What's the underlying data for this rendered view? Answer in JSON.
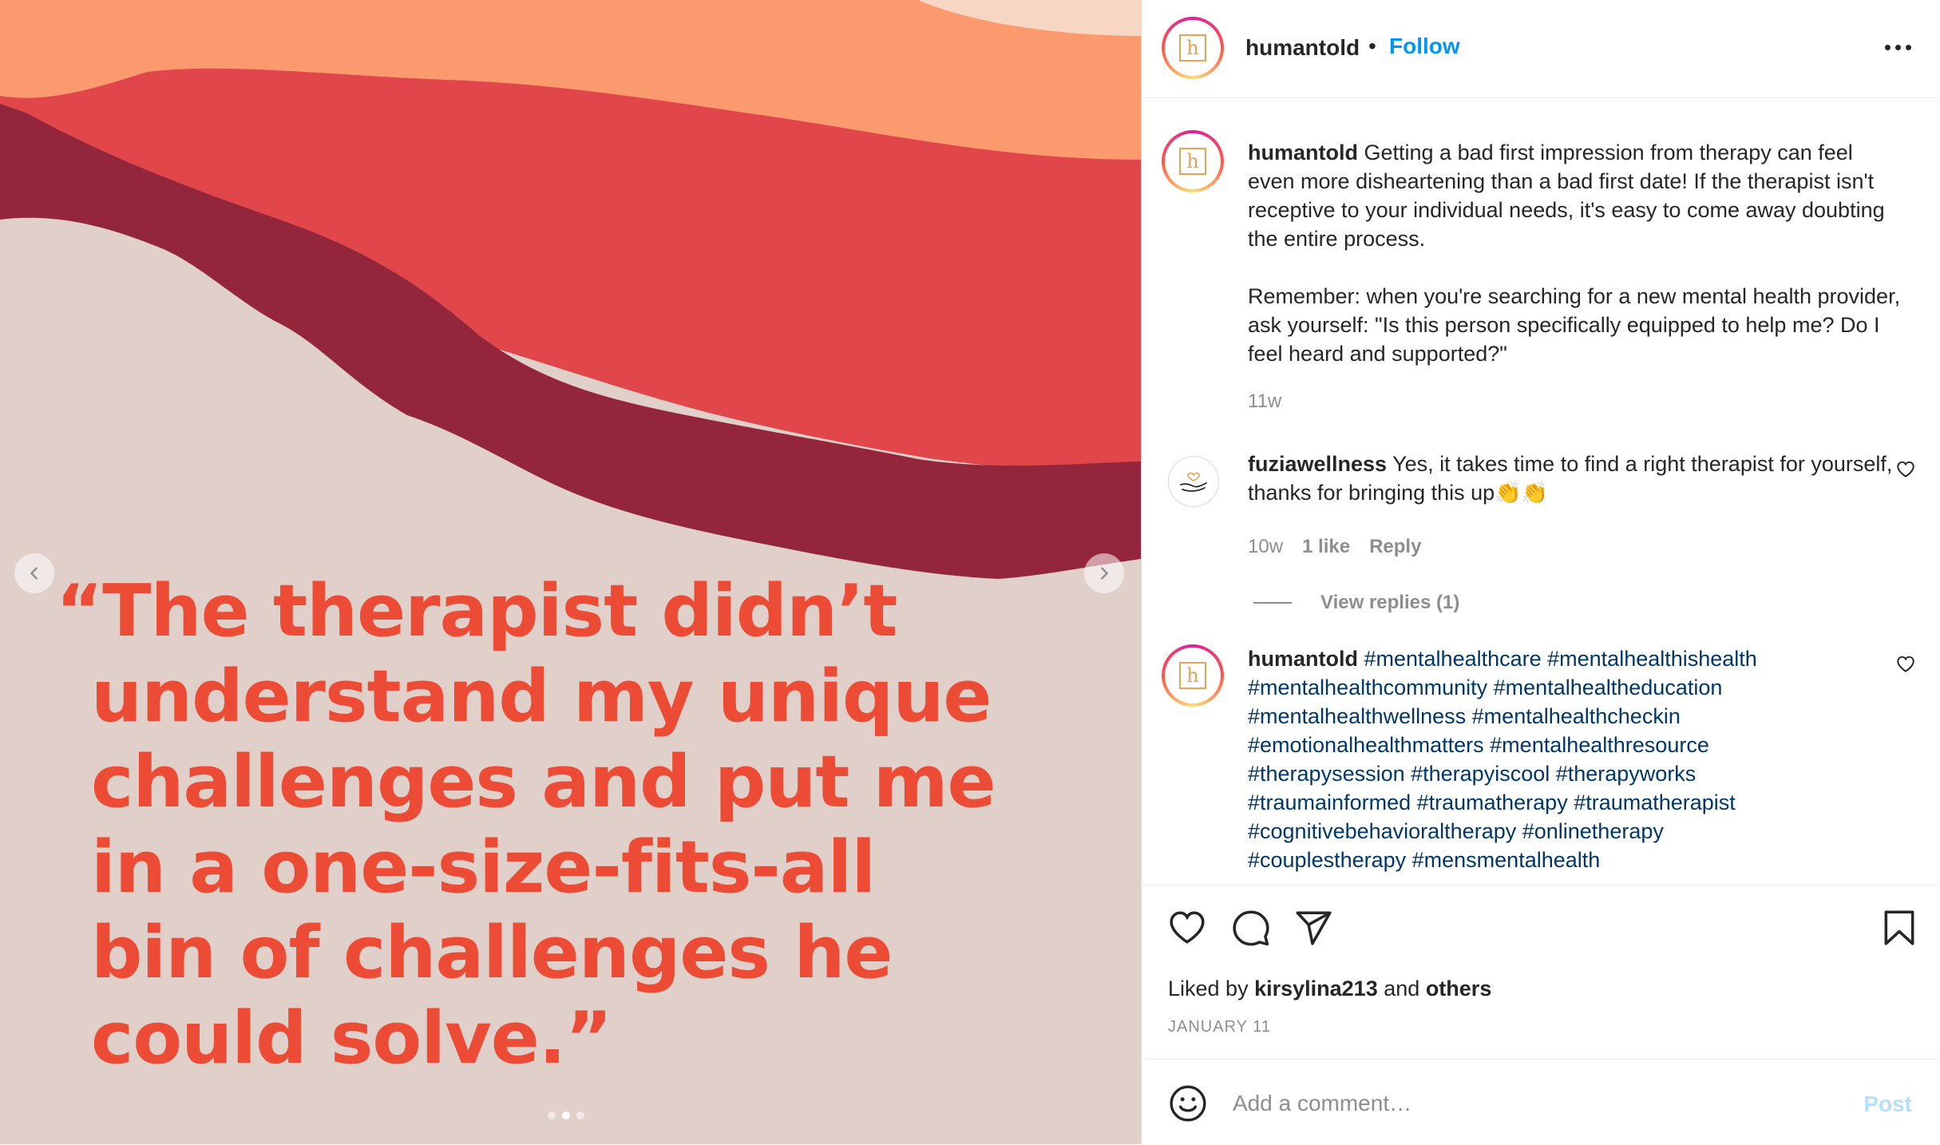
{
  "media": {
    "quote_lines": [
      "“The therapist didn’t",
      "understand my unique",
      "challenges and put me",
      "in a one-size-fits-all",
      "bin of challenges he",
      "could solve.”"
    ],
    "slide_count": 3,
    "active_slide": 2,
    "colors": {
      "background": "#e1cfc9",
      "band_peach": "#fb9a6e",
      "band_light": "#f7d7c4",
      "band_red": "#e0464a",
      "band_maroon": "#93263b",
      "quote_text": "#ec4c35"
    }
  },
  "header": {
    "username": "humantold",
    "separator": "•",
    "follow_label": "Follow",
    "avatar_letter": "h"
  },
  "caption": {
    "username": "humantold",
    "paragraph1": "Getting a bad first impression from therapy can feel even more disheartening than a bad first date! If the therapist isn't receptive to your individual needs, it's easy to come away doubting the entire process.",
    "paragraph2": "Remember: when you're searching for a new mental health provider, ask yourself: \"Is this person specifically equipped to help me? Do I feel heard and supported?\"",
    "time": "11w"
  },
  "comments": [
    {
      "username": "fuziawellness",
      "text": "Yes, it takes time to find a right therapist for yourself, thanks for bringing this up",
      "emoji": "👏👏",
      "time": "10w",
      "likes": "1 like",
      "reply_label": "Reply",
      "view_replies": "View replies (1)"
    },
    {
      "username": "humantold",
      "hashtags": "#mentalhealthcare #mentalhealthishealth #mentalhealthcommunity #mentalhealtheducation #mentalhealthwellness #mentalhealthcheckin #emotionalhealthmatters #mentalhealthresource #therapysession #therapyiscool #therapyworks #traumainformed #traumatherapy #traumatherapist #cognitivebehavioraltherapy #onlinetherapy #couplestherapy #mensmentalhealth"
    }
  ],
  "actions": {
    "liked_by_prefix": "Liked by",
    "liked_by_user": "kirsylina213",
    "liked_by_and": "and",
    "liked_by_others": "others",
    "date": "JANUARY 11"
  },
  "comment_box": {
    "placeholder": "Add a comment…",
    "post_label": "Post"
  },
  "icons": {
    "prev": "chevron-left-icon",
    "next": "chevron-right-icon",
    "more": "more-horizontal-icon",
    "like": "heart-icon",
    "comment": "comment-bubble-icon",
    "share": "paper-plane-icon",
    "save": "bookmark-icon",
    "emoji": "smiley-icon"
  }
}
